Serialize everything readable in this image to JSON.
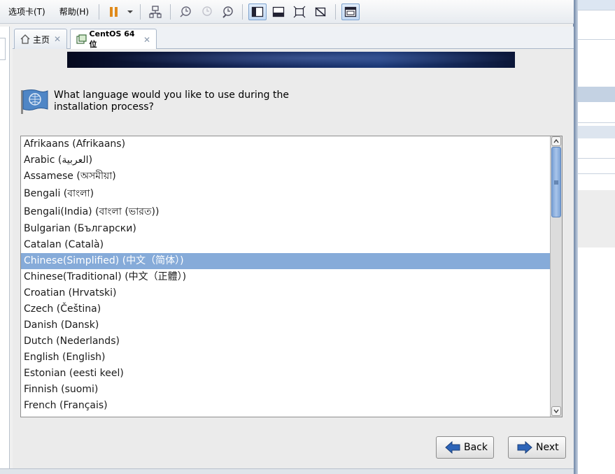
{
  "menubar": {
    "items": [
      "选项卡(T)",
      "帮助(H)"
    ]
  },
  "tabs": {
    "home_label": "主页",
    "vm_label": "CentOS 64 位",
    "close_glyph": "✕"
  },
  "installer": {
    "question_line1": "What language would you like to use during the",
    "question_line2": "installation process?",
    "languages": [
      "Afrikaans (Afrikaans)",
      "Arabic (العربية)",
      "Assamese (অসমীয়া)",
      "Bengali (বাংলা)",
      "Bengali(India) (বাংলা (ভারত))",
      "Bulgarian (Български)",
      "Catalan (Català)",
      "Chinese(Simplified) (中文（简体）)",
      "Chinese(Traditional) (中文（正體）)",
      "Croatian (Hrvatski)",
      "Czech (Čeština)",
      "Danish (Dansk)",
      "Dutch (Nederlands)",
      "English (English)",
      "Estonian (eesti keel)",
      "Finnish (suomi)",
      "French (Français)"
    ],
    "selected_index": 7,
    "back_label": "Back",
    "next_label": "Next"
  },
  "colors": {
    "selection": "#86abd9",
    "scroll_thumb": "#7aa2d6",
    "banner_dark": "#05091e",
    "button_arrow": "#2d64b8"
  }
}
